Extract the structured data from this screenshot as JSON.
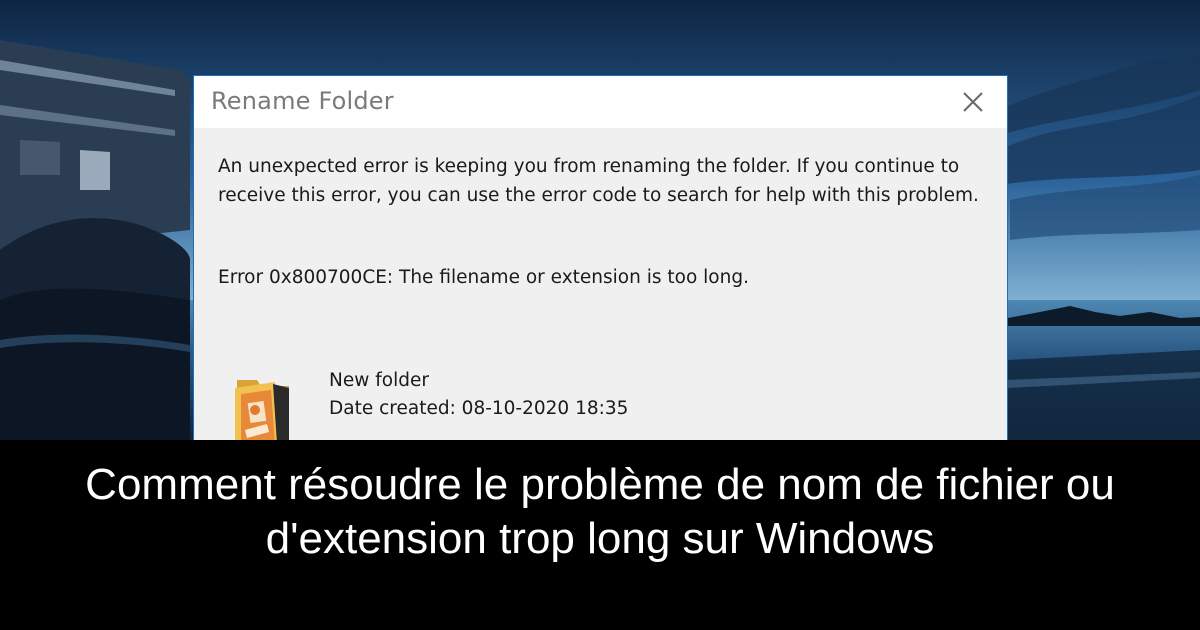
{
  "dialog": {
    "title": "Rename Folder",
    "message": "An unexpected error is keeping you from renaming the folder. If you continue to receive this error, you can use the error code to search for help with this problem.",
    "error": "Error 0x800700CE: The filename or extension is too long.",
    "item": {
      "name": "New folder",
      "date_created": "Date created: 08-10-2020 18:35",
      "icon": "folder-icon"
    },
    "close_icon": "close-icon",
    "accent_color": "#1f6fb8"
  },
  "caption": {
    "text": "Comment résoudre le problème de nom de fichier ou d'extension trop long sur Windows"
  }
}
